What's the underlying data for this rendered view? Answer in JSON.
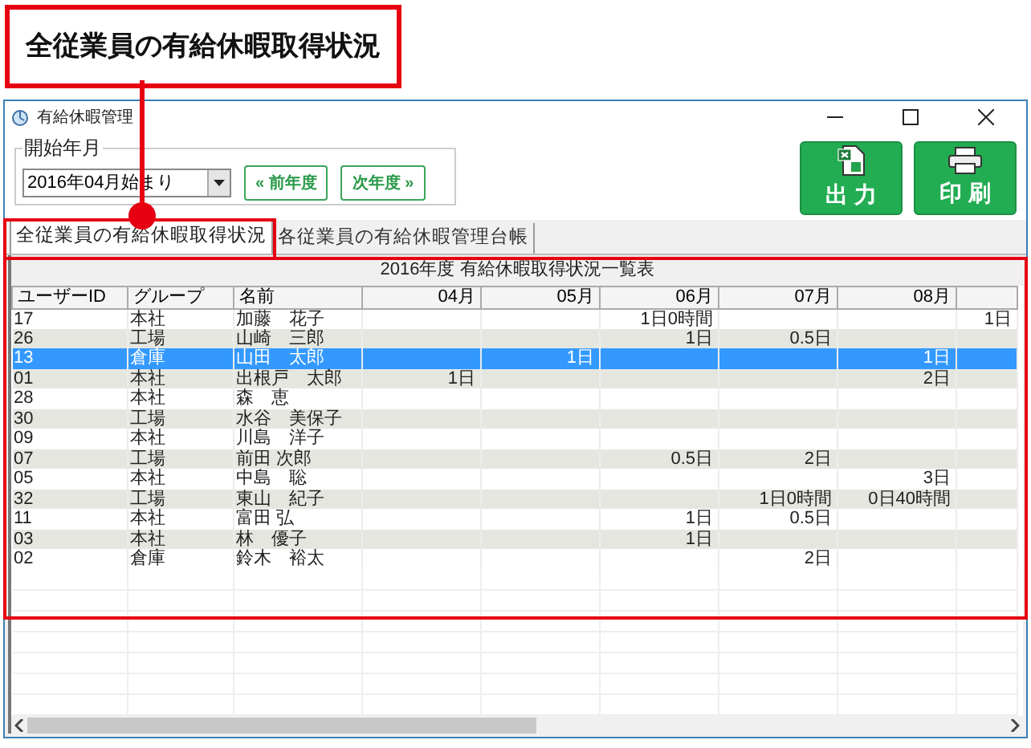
{
  "callout": {
    "label": "全従業員の有給休暇取得状況"
  },
  "window": {
    "title": "有給休暇管理"
  },
  "period": {
    "legend": "開始年月",
    "value": "2016年04月始まり"
  },
  "nav_buttons": [
    {
      "label": "« 前年度"
    },
    {
      "label": "次年度 »"
    }
  ],
  "action_buttons": [
    {
      "kind": "export",
      "label": "出 力"
    },
    {
      "kind": "print",
      "label": "印 刷"
    }
  ],
  "tabs": [
    {
      "label": "全従業員の有給休暇取得状況",
      "selected": true
    },
    {
      "label": "各従業員の有給休暇管理台帳",
      "selected": false
    }
  ],
  "table": {
    "title": "2016年度 有給休暇取得状況一覧表",
    "columns": [
      "ユーザーID",
      "グループ",
      "名前",
      "04月",
      "05月",
      "06月",
      "07月",
      "08月",
      null
    ],
    "rows": [
      {
        "selected": false,
        "cells": [
          "17",
          "本社",
          "加藤　花子",
          null,
          null,
          "1日0時間",
          null,
          null,
          "1日"
        ]
      },
      {
        "selected": false,
        "cells": [
          "26",
          "工場",
          "山崎　三郎",
          null,
          null,
          "1日",
          "0.5日",
          null,
          null
        ]
      },
      {
        "selected": true,
        "cells": [
          "13",
          "倉庫",
          "山田　太郎",
          null,
          "1日",
          null,
          null,
          "1日",
          null
        ]
      },
      {
        "selected": false,
        "cells": [
          "01",
          "本社",
          "出根戸　太郎",
          "1日",
          null,
          null,
          null,
          "2日",
          null
        ]
      },
      {
        "selected": false,
        "cells": [
          "28",
          "本社",
          "森　恵",
          null,
          null,
          null,
          null,
          null,
          null
        ]
      },
      {
        "selected": false,
        "cells": [
          "30",
          "工場",
          "水谷　美保子",
          null,
          null,
          null,
          null,
          null,
          null
        ]
      },
      {
        "selected": false,
        "cells": [
          "09",
          "本社",
          "川島　洋子",
          null,
          null,
          null,
          null,
          null,
          null
        ]
      },
      {
        "selected": false,
        "cells": [
          "07",
          "工場",
          "前田 次郎",
          null,
          null,
          "0.5日",
          "2日",
          null,
          null
        ]
      },
      {
        "selected": false,
        "cells": [
          "05",
          "本社",
          "中島　聡",
          null,
          null,
          null,
          null,
          "3日",
          null
        ]
      },
      {
        "selected": false,
        "cells": [
          "32",
          "工場",
          "東山　紀子",
          null,
          null,
          null,
          "1日0時間",
          "0日40時間",
          null
        ]
      },
      {
        "selected": false,
        "cells": [
          "11",
          "本社",
          "富田 弘",
          null,
          null,
          "1日",
          "0.5日",
          null,
          null
        ]
      },
      {
        "selected": false,
        "cells": [
          "03",
          "本社",
          "林　優子",
          null,
          null,
          "1日",
          null,
          null,
          null
        ]
      },
      {
        "selected": false,
        "cells": [
          "02",
          "倉庫",
          "鈴木　裕太",
          null,
          null,
          null,
          "2日",
          null,
          null
        ]
      }
    ]
  }
}
